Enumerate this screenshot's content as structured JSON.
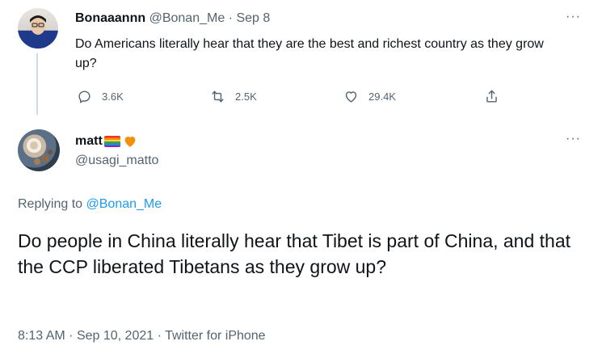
{
  "parent_tweet": {
    "display_name": "Bonaaannn",
    "handle": "@Bonan_Me",
    "separator": "·",
    "date": "Sep 8",
    "text": "Do Americans literally hear that they are the best and richest country as they grow up?",
    "replies": "3.6K",
    "retweets": "2.5K",
    "likes": "29.4K",
    "more": "···"
  },
  "main_tweet": {
    "display_name": "matt",
    "name_emojis": [
      "rainbow-flag-emoji",
      "orange-heart-emoji"
    ],
    "handle": "@usagi_matto",
    "more": "···",
    "replying_prefix": "Replying to",
    "replying_to": "@Bonan_Me",
    "text": "Do people in China literally hear that Tibet is part of China, and that the CCP liberated Tibetans as they grow up?",
    "time": "8:13 AM",
    "date": "Sep 10, 2021",
    "source": "Twitter for iPhone",
    "separator": "·"
  },
  "colors": {
    "text_primary": "#0f1419",
    "text_secondary": "#536471",
    "link": "#1d9bf0",
    "thread_line": "#cfd9de"
  }
}
